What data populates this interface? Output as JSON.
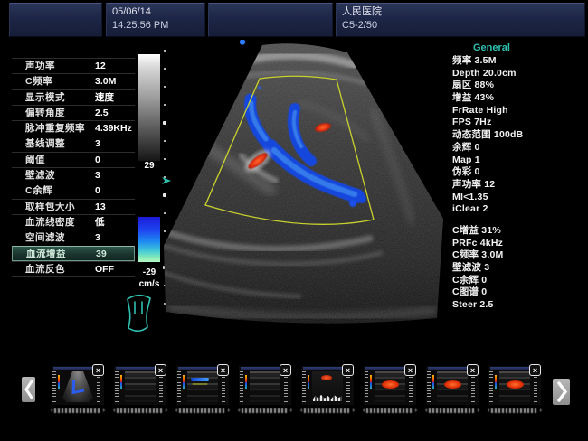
{
  "topbar": {
    "date": "05/06/14",
    "time": "14:25:56 PM",
    "hospital": "人民医院",
    "probe": "C5-2/50"
  },
  "left_params": {
    "rows": [
      {
        "label": "声功率",
        "value": "12"
      },
      {
        "label": "C频率",
        "value": "3.0M"
      },
      {
        "label": "显示模式",
        "value": "速度"
      },
      {
        "label": "偏转角度",
        "value": "2.5"
      },
      {
        "label": "脉冲重复频率",
        "value": "4.39KHz"
      },
      {
        "label": "基线调整",
        "value": "3"
      },
      {
        "label": "阈值",
        "value": "0"
      },
      {
        "label": "壁滤波",
        "value": "3"
      },
      {
        "label": "C余辉",
        "value": "0"
      },
      {
        "label": "取样包大小",
        "value": "13"
      },
      {
        "label": "血流线密度",
        "value": "低"
      },
      {
        "label": "空间滤波",
        "value": "3"
      },
      {
        "label": "血流增益",
        "value": "39",
        "highlighted": true
      },
      {
        "label": "血流反色",
        "value": "OFF"
      }
    ]
  },
  "scale": {
    "max": "29",
    "min": "-29",
    "unit": "cm/s"
  },
  "right_info": {
    "header": "General",
    "group1": [
      "频率 3.5M",
      "Depth 20.0cm",
      "扇区 88%",
      "增益 43%",
      "FrRate High",
      "FPS 7Hz",
      "动态范围 100dB",
      "余辉 0",
      "Map 1",
      "伪彩 0",
      "声功率 12",
      "MI<1.35",
      "iClear 2"
    ],
    "group2": [
      "C增益 31%",
      "PRFc 4kHz",
      "C频率 3.0M",
      "壁滤波 3",
      "C余辉 0",
      "C图谱 0",
      "Steer 2.5"
    ]
  },
  "thumbstrip": {
    "close_glyph": "×",
    "nav_left_icon": "chevron-left",
    "nav_right_icon": "chevron-right",
    "items": [
      {
        "kind": "fan-color"
      },
      {
        "kind": "linear"
      },
      {
        "kind": "linear-color"
      },
      {
        "kind": "linear"
      },
      {
        "kind": "spectral-red"
      },
      {
        "kind": "linear-red"
      },
      {
        "kind": "linear-red"
      },
      {
        "kind": "linear-red"
      }
    ]
  },
  "colors": {
    "accent_teal": "#2fc0b0",
    "roi_yellow": "#c8d22e",
    "doppler_blue": "#1646dd",
    "doppler_red": "#e63312",
    "topbar_navy": "#1d2646"
  }
}
